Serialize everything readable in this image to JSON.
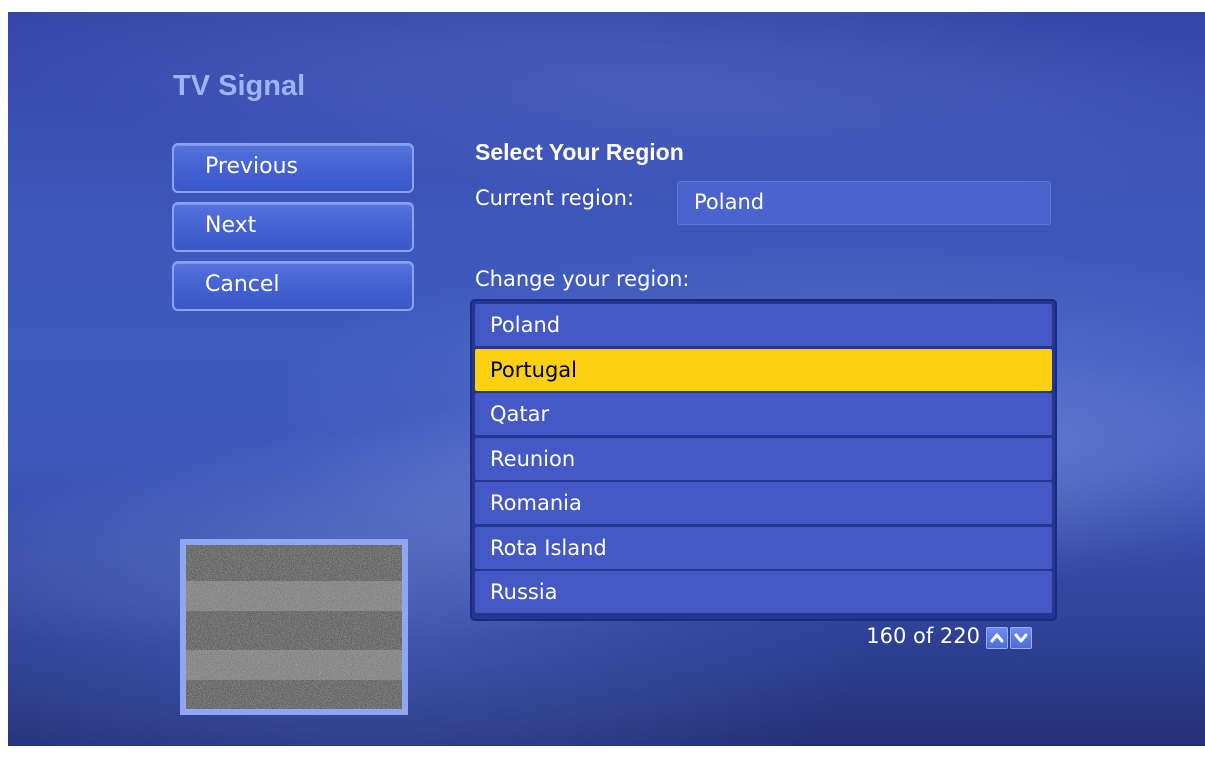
{
  "page": {
    "title": "TV Signal"
  },
  "nav": {
    "buttons": [
      {
        "label": "Previous"
      },
      {
        "label": "Next"
      },
      {
        "label": "Cancel"
      }
    ]
  },
  "region": {
    "heading": "Select Your Region",
    "current_label": "Current region:",
    "current_value": "Poland",
    "change_label": "Change your region:",
    "list": [
      "Poland",
      "Portugal",
      "Qatar",
      "Reunion",
      "Romania",
      "Rota Island",
      "Russia"
    ],
    "selected": "Portugal",
    "pager_text": "160 of 220"
  },
  "icons": {
    "page_up": "chevron-up-icon",
    "page_down": "chevron-down-icon"
  },
  "colors": {
    "selection": "#fbd010",
    "title": "#9fb4f7"
  }
}
